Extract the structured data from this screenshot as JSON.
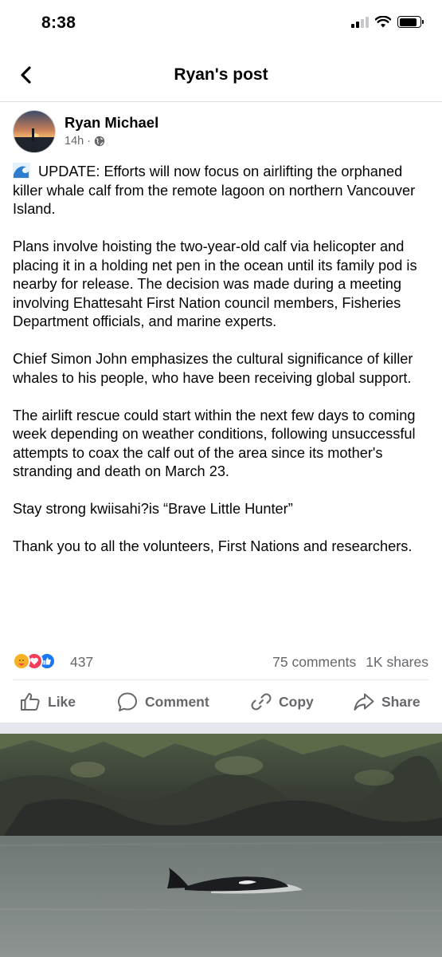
{
  "status": {
    "time": "8:38"
  },
  "nav": {
    "title": "Ryan's post",
    "back_icon": "chevron-left-icon"
  },
  "post": {
    "author": "Ryan Michael",
    "time": "14h",
    "separator": "·",
    "audience_icon": "globe-icon",
    "emoji_icon": "wave-icon",
    "paragraphs": [
      "UPDATE: Efforts will now focus on airlifting the orphaned killer whale calf from the remote lagoon on northern Vancouver Island.",
      "Plans involve hoisting the two-year-old calf via helicopter and placing it in a holding net pen in the ocean until its family pod is nearby for release. The decision was made during a meeting involving Ehattesaht First Nation council members, Fisheries Department officials, and marine experts.",
      "Chief Simon John emphasizes the cultural significance of killer whales to his people, who have been receiving global support.",
      "The airlift rescue could start within the next few days to coming week depending on weather conditions, following unsuccessful attempts to coax the calf out of the area since its mother's stranding and death on March 23.",
      "Stay strong kwiisahi?is “Brave Little Hunter”",
      "Thank you to all the volunteers, First Nations and researchers."
    ]
  },
  "stats": {
    "reactions": "437",
    "comments": "75 comments",
    "shares": "1K shares",
    "reaction_icons": [
      "care-icon",
      "love-icon",
      "like-icon"
    ]
  },
  "actions": {
    "like": "Like",
    "comment": "Comment",
    "copy": "Copy",
    "share": "Share"
  },
  "colors": {
    "text": "#050505",
    "secondary": "#65676b",
    "like_blue": "#1877f2",
    "love_red": "#f33e58",
    "care_yellow": "#f7b125"
  }
}
